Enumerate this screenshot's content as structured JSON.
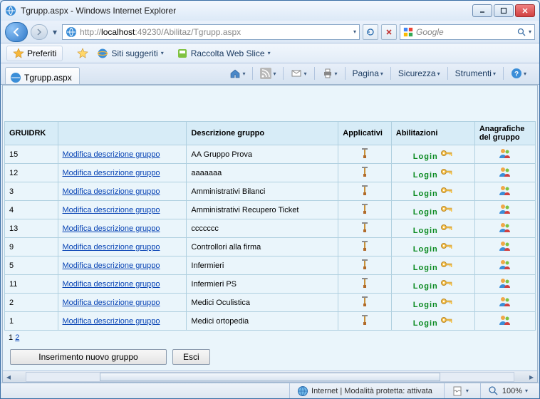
{
  "window": {
    "title": "Tgrupp.aspx - Windows Internet Explorer"
  },
  "address": {
    "prefix": "http://",
    "host": "localhost",
    "rest": ":49230/Abilitaz/Tgrupp.aspx"
  },
  "search": {
    "engine": "Google"
  },
  "favorites": {
    "button": "Preferiti",
    "suggested": "Siti suggeriti",
    "webslice": "Raccolta Web Slice"
  },
  "tab": {
    "label": "Tgrupp.aspx"
  },
  "commandbar": {
    "page": "Pagina",
    "security": "Sicurezza",
    "tools": "Strumenti"
  },
  "grid": {
    "headers": {
      "id": "GRUIDRK",
      "editcol": "",
      "desc": "Descrizione gruppo",
      "apps": "Applicativi",
      "abil": "Abilitazioni",
      "anag": "Anagrafiche del gruppo"
    },
    "edit_link_label": "Modifica descrizione gruppo",
    "login_label": "Login",
    "rows": [
      {
        "id": "15",
        "desc": "AA Gruppo Prova"
      },
      {
        "id": "12",
        "desc": "aaaaaaa"
      },
      {
        "id": "3",
        "desc": "Amministrativi Bilanci"
      },
      {
        "id": "4",
        "desc": "Amministrativi Recupero Ticket"
      },
      {
        "id": "13",
        "desc": "ccccccc"
      },
      {
        "id": "9",
        "desc": "Controllori alla firma"
      },
      {
        "id": "5",
        "desc": "Infermieri"
      },
      {
        "id": "11",
        "desc": "Infermieri PS"
      },
      {
        "id": "2",
        "desc": "Medici Oculistica"
      },
      {
        "id": "1",
        "desc": "Medici ortopedia"
      }
    ],
    "pager": {
      "current": "1",
      "other": "2"
    }
  },
  "buttons": {
    "insert": "Inserimento nuovo gruppo",
    "exit": "Esci"
  },
  "status": {
    "zone": "Internet | Modalità protetta: attivata",
    "zoom": "100%"
  }
}
